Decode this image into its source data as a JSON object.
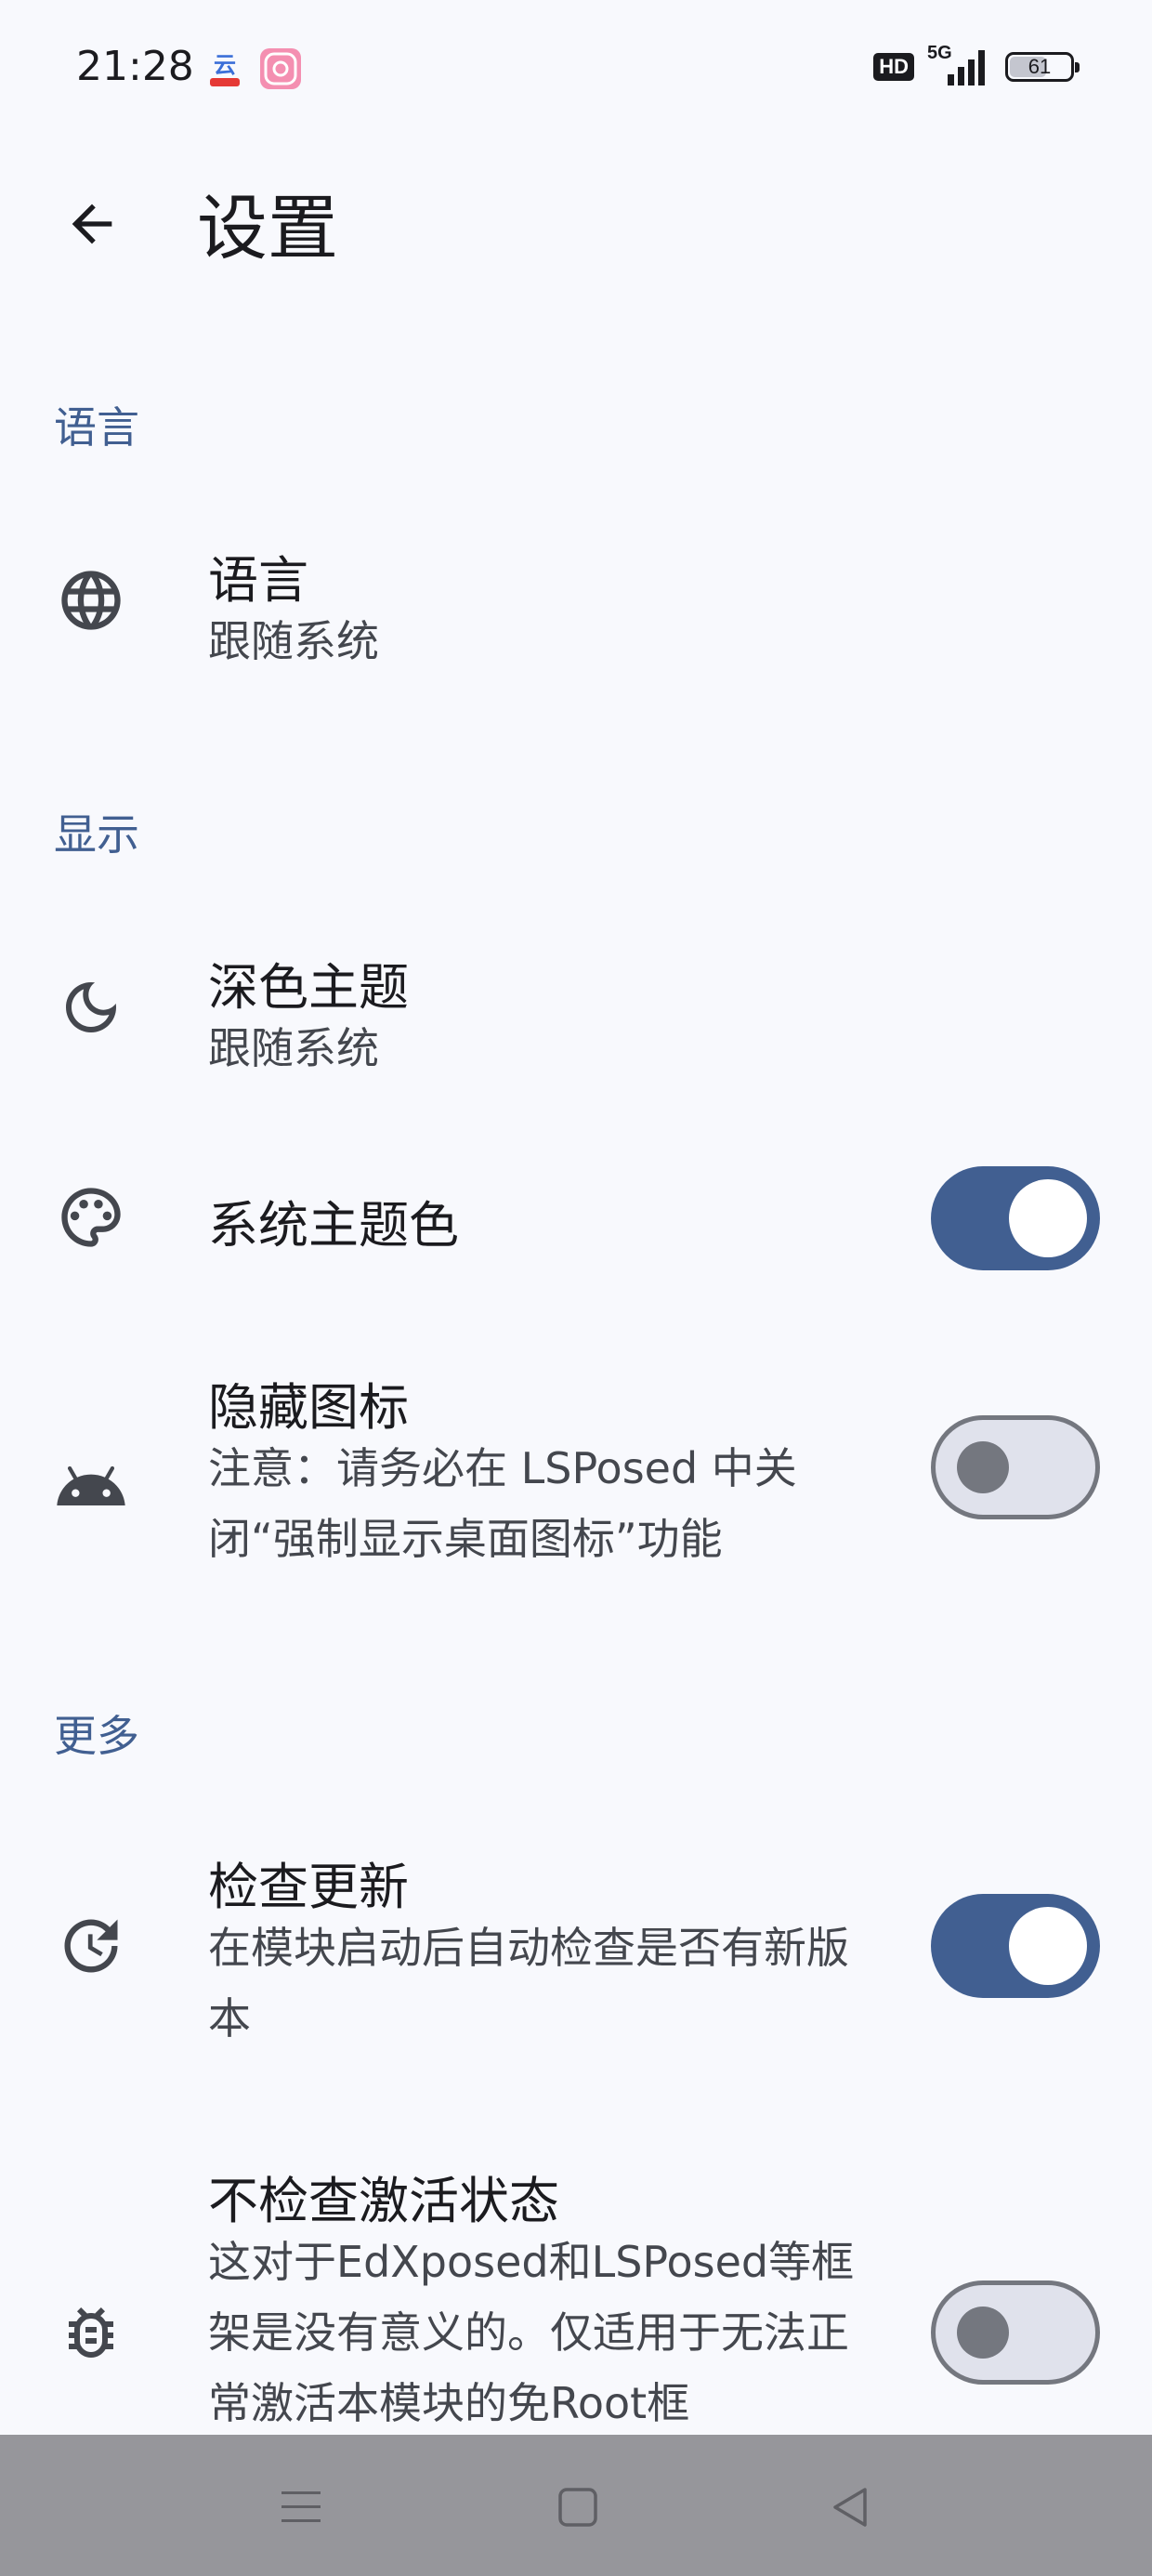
{
  "status_bar": {
    "time": "21:28",
    "hd_badge": "HD",
    "network": "5G",
    "battery": "61",
    "battery_level_percent": 61
  },
  "app_bar": {
    "title": "设置"
  },
  "sections": {
    "language": {
      "header": "语言",
      "language_pref": {
        "title": "语言",
        "summary": "跟随系统",
        "icon": "globe-icon"
      }
    },
    "display": {
      "header": "显示",
      "dark_theme": {
        "title": "深色主题",
        "summary": "跟随系统",
        "icon": "moon-icon"
      },
      "system_theme_color": {
        "title": "系统主题色",
        "icon": "palette-icon",
        "enabled": true
      },
      "hide_icon": {
        "title": "隐藏图标",
        "summary": "注意：请务必在 LSPosed 中关闭“强制显示桌面图标”功能",
        "icon": "android-icon",
        "enabled": false
      }
    },
    "more": {
      "header": "更多",
      "check_update": {
        "title": "检查更新",
        "summary": "在模块启动后自动检查是否有新版本",
        "icon": "update-icon",
        "enabled": true
      },
      "skip_activation_check": {
        "title": "不检查激活状态",
        "summary": "这对于EdXposed和LSPosed等框架是没有意义的。仅适用于无法正常激活本模块的免Root框",
        "icon": "bug-icon",
        "enabled": false
      }
    }
  },
  "colors": {
    "accent": "#415f91",
    "background": "#f8f9fd",
    "nav_bar": "#96969b"
  }
}
